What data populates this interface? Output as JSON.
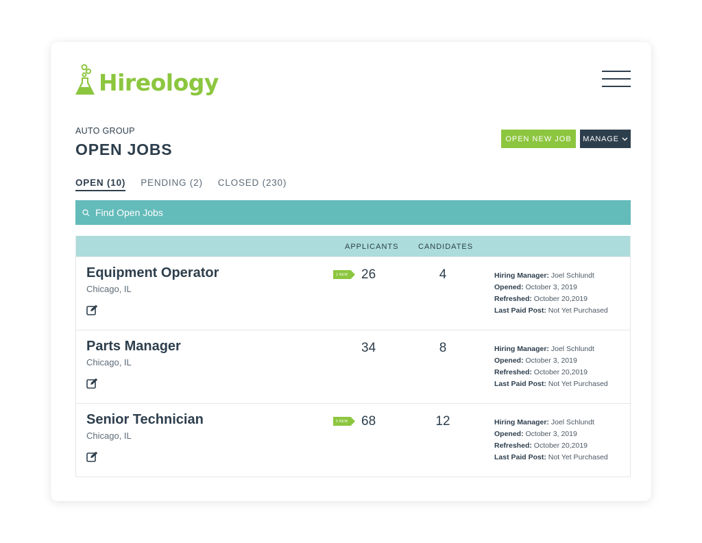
{
  "brand": {
    "name": "Hireology",
    "color": "#8cc63f"
  },
  "header": {
    "menu_icon": "hamburger-icon"
  },
  "page": {
    "subtitle": "AUTO GROUP",
    "title": "OPEN JOBS"
  },
  "actions": {
    "open_new_job": "OPEN NEW JOB",
    "manage": "MANAGE"
  },
  "tabs": [
    {
      "label": "OPEN (10)",
      "active": true
    },
    {
      "label": "PENDING (2)",
      "active": false
    },
    {
      "label": "CLOSED (230)",
      "active": false
    }
  ],
  "search": {
    "placeholder": "Find Open Jobs",
    "icon": "search-icon"
  },
  "table": {
    "columns": {
      "applicants": "APPLICANTS",
      "candidates": "CANDIDATES"
    },
    "meta_labels": {
      "hiring_manager": "Hiring Manager:",
      "opened": "Opened:",
      "refreshed": "Refreshed:",
      "last_paid_post": "Last Paid Post:"
    },
    "rows": [
      {
        "title": "Equipment Operator",
        "location": "Chicago, IL",
        "badge": "1 NEW",
        "applicants": "26",
        "candidates": "4",
        "hiring_manager": "Joel Schlundt",
        "opened": "October 3, 2019",
        "refreshed": "October 20,2019",
        "last_paid_post": "Not Yet Purchased"
      },
      {
        "title": "Parts Manager",
        "location": "Chicago, IL",
        "badge": "",
        "applicants": "34",
        "candidates": "8",
        "hiring_manager": "Joel Schlundt",
        "opened": "October 3, 2019",
        "refreshed": "October 20,2019",
        "last_paid_post": "Not Yet Purchased"
      },
      {
        "title": "Senior Technician",
        "location": "Chicago, IL",
        "badge": "5 NEW",
        "applicants": "68",
        "candidates": "12",
        "hiring_manager": "Joel Schlundt",
        "opened": "October 3, 2019",
        "refreshed": "October 20,2019",
        "last_paid_post": "Not Yet Purchased"
      }
    ]
  },
  "colors": {
    "accent_green": "#8cc63f",
    "navy": "#2d3e4c",
    "search_teal": "#63bbba",
    "header_teal": "#acdcdb"
  }
}
